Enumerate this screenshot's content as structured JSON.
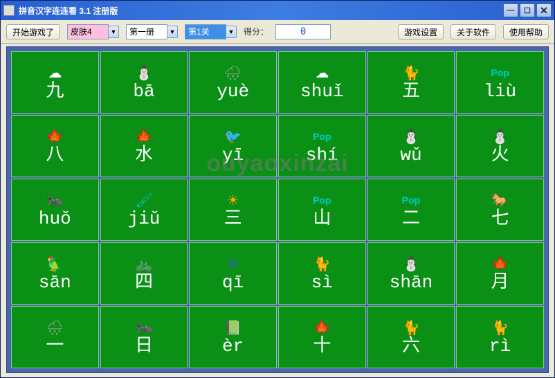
{
  "window": {
    "title": "拼音汉字连连看  3.1 注册版"
  },
  "toolbar": {
    "start_label": "开始游戏了",
    "skin_label": "皮肤4",
    "volume_label": "第一册",
    "level_label": "第1关",
    "score_label": "得分：",
    "score_value": "0",
    "settings_label": "游戏设置",
    "about_label": "关于软件",
    "help_label": "使用帮助"
  },
  "watermark": "ouyaoxinzai",
  "grid": {
    "rows": 5,
    "cols": 6,
    "tiles": [
      [
        {
          "icon": "☁",
          "cls": "ic-cloud",
          "text": "九"
        },
        {
          "icon": "⛄",
          "cls": "ic-snowman",
          "text": "bā"
        },
        {
          "icon": "🌧",
          "cls": "ic-rain",
          "text": "yuè"
        },
        {
          "icon": "☁",
          "cls": "ic-cloud",
          "text": "shuǐ"
        },
        {
          "icon": "🐈",
          "cls": "ic-cat",
          "text": "五"
        },
        {
          "icon": "Pop",
          "cls": "ic-popup",
          "text": "liù"
        }
      ],
      [
        {
          "icon": "🍁",
          "cls": "ic-leaf",
          "text": "八"
        },
        {
          "icon": "🍁",
          "cls": "ic-leaf",
          "text": "水"
        },
        {
          "icon": "🐦",
          "cls": "ic-bird",
          "text": "yī"
        },
        {
          "icon": "Pop",
          "cls": "ic-popup",
          "text": "shí"
        },
        {
          "icon": "⛄",
          "cls": "ic-snowman",
          "text": "wǔ"
        },
        {
          "icon": "⛄",
          "cls": "ic-snowman",
          "text": "火"
        }
      ],
      [
        {
          "icon": "🐜",
          "cls": "ic-ant",
          "text": "huǒ"
        },
        {
          "icon": "🖌",
          "cls": "ic-paint",
          "text": "jiǔ"
        },
        {
          "icon": "☀",
          "cls": "ic-sun",
          "text": "三"
        },
        {
          "icon": "Pop",
          "cls": "ic-popup",
          "text": "山"
        },
        {
          "icon": "Pop",
          "cls": "ic-popup",
          "text": "二"
        },
        {
          "icon": "🐎",
          "cls": "ic-horse",
          "text": "七"
        }
      ],
      [
        {
          "icon": "🦜",
          "cls": "ic-parrot",
          "text": "sān"
        },
        {
          "icon": "🚲",
          "cls": "ic-bike",
          "text": "四"
        },
        {
          "icon": "⚛",
          "cls": "ic-atom",
          "text": "qī"
        },
        {
          "icon": "🐈",
          "cls": "ic-cat",
          "text": "sì"
        },
        {
          "icon": "⛄",
          "cls": "ic-snowman",
          "text": "shān"
        },
        {
          "icon": "🍁",
          "cls": "ic-maple",
          "text": "月"
        }
      ],
      [
        {
          "icon": "🌧",
          "cls": "ic-rain",
          "text": "一"
        },
        {
          "icon": "🐜",
          "cls": "ic-ant",
          "text": "日"
        },
        {
          "icon": "📗",
          "cls": "ic-book",
          "text": "èr"
        },
        {
          "icon": "🍁",
          "cls": "ic-maple",
          "text": "十"
        },
        {
          "icon": "🐈",
          "cls": "ic-cat",
          "text": "六"
        },
        {
          "icon": "🐈",
          "cls": "ic-cat",
          "text": "rì"
        }
      ]
    ]
  }
}
